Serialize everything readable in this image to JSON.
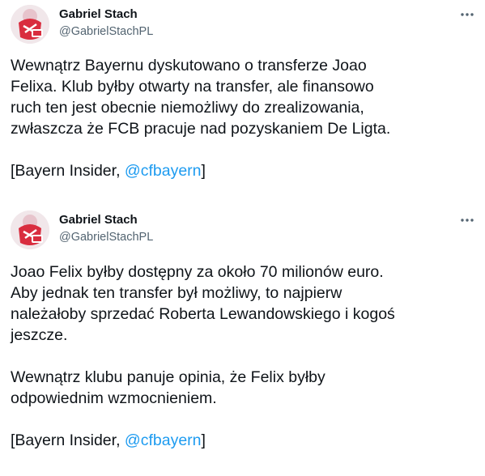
{
  "tweets": [
    {
      "author": {
        "name": "Gabriel Stach",
        "handle": "@GabrielStachPL"
      },
      "more_icon": "more-horizontal-icon",
      "body": [
        "Wewnątrz Bayernu dyskutowano o transferze Joao",
        "Felixa. Klub byłby otwarty na transfer, ale finansowo",
        "ruch ten jest obecnie niemożliwy do zrealizowania,",
        "zwłaszcza że FCB pracuje nad pozyskaniem De Ligta."
      ],
      "source": {
        "prefix": "[Bayern Insider, ",
        "link": "@cfbayern",
        "suffix": "]"
      }
    },
    {
      "author": {
        "name": "Gabriel Stach",
        "handle": "@GabrielStachPL"
      },
      "more_icon": "more-horizontal-icon",
      "body": [
        "Joao Felix byłby dostępny za około 70 milionów euro.",
        "Aby jednak ten transfer był możliwy, to najpierw",
        "należałoby sprzedać Roberta Lewandowskiego i kogoś",
        "jeszcze."
      ],
      "body_2": [
        "Wewnątrz klubu panuje opinia, że Felix byłby",
        "odpowiednim wzmocnieniem."
      ],
      "source": {
        "prefix": "[Bayern Insider, ",
        "link": "@cfbayern",
        "suffix": "]"
      }
    }
  ],
  "colors": {
    "text": "#0f1419",
    "secondary": "#536471",
    "link": "#1d9bf0",
    "background": "#ffffff"
  }
}
